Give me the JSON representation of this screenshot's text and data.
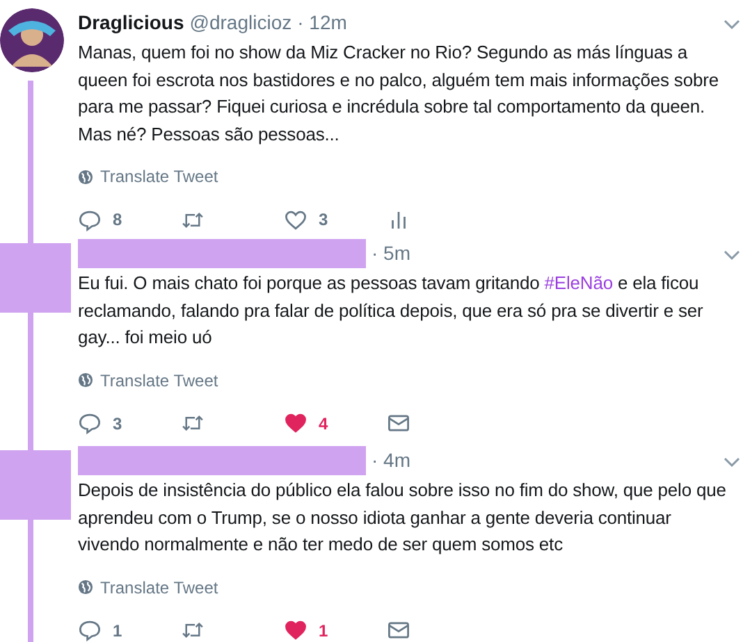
{
  "tweets": [
    {
      "redacted": false,
      "name": "Draglicious",
      "handle": "@draglicioz",
      "time": "· 12m",
      "segments": [
        {
          "kind": "text",
          "text": "Manas, quem foi no show da Miz Cracker no Rio? Segundo as más línguas a queen foi escrota nos bastidores e no palco, alguém tem mais informações sobre para me passar? Fiquei curiosa e incrédula sobre tal comportamento da queen. Mas né? Pessoas são pessoas..."
        }
      ],
      "translate": "Translate Tweet",
      "actions": [
        {
          "kind": "reply",
          "count": "8",
          "active": false
        },
        {
          "kind": "retweet",
          "active": false
        },
        {
          "kind": "like",
          "count": "3",
          "active": false
        },
        {
          "kind": "analytics",
          "active": false
        }
      ]
    },
    {
      "redacted": true,
      "time": "· 5m",
      "segments": [
        {
          "kind": "text",
          "text": "Eu fui. O mais chato foi porque as pessoas tavam gritando "
        },
        {
          "kind": "hashtag",
          "text": "#EleNão"
        },
        {
          "kind": "text",
          "text": " e ela ficou reclamando, falando pra falar de política depois, que era só pra se divertir e ser gay... foi meio uó"
        }
      ],
      "translate": "Translate Tweet",
      "actions": [
        {
          "kind": "reply",
          "count": "3",
          "active": false
        },
        {
          "kind": "retweet",
          "active": false
        },
        {
          "kind": "like",
          "count": "4",
          "active": true
        },
        {
          "kind": "message",
          "active": false
        }
      ]
    },
    {
      "redacted": true,
      "time": "· 4m",
      "segments": [
        {
          "kind": "text",
          "text": "Depois de insistência do público ela falou sobre isso no fim do show, que pelo que aprendeu com o Trump, se o nosso idiota ganhar a gente deveria continuar vivendo normalmente e não ter medo de ser quem somos etc"
        }
      ],
      "translate": "Translate Tweet",
      "actions": [
        {
          "kind": "reply",
          "count": "1",
          "active": false
        },
        {
          "kind": "retweet",
          "active": false
        },
        {
          "kind": "like",
          "count": "1",
          "active": true
        },
        {
          "kind": "message",
          "active": false
        }
      ]
    }
  ]
}
